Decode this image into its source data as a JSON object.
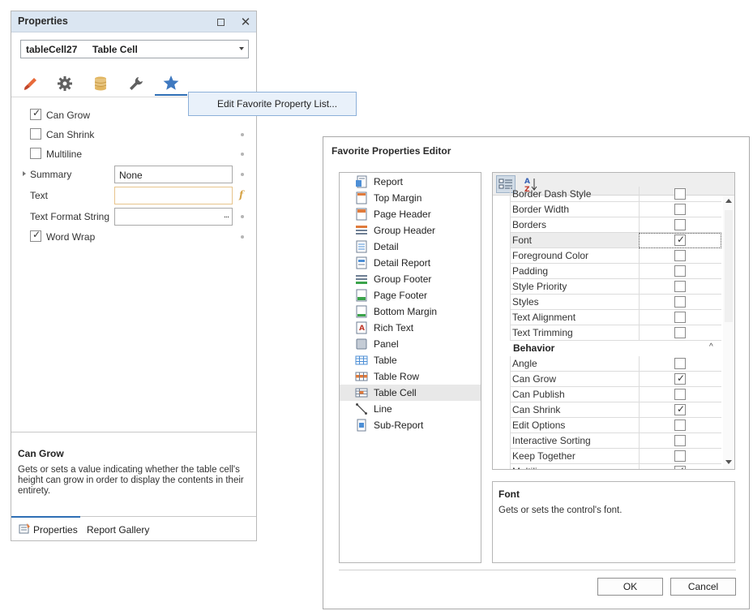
{
  "properties_panel": {
    "title": "Properties",
    "restore_icon": "restore-window-icon",
    "close_glyph": "✕",
    "selected_object": {
      "name": "tableCell27",
      "type": "Table Cell"
    },
    "tabs": [
      {
        "icon": "brush-icon"
      },
      {
        "icon": "gear-icon"
      },
      {
        "icon": "database-icon"
      },
      {
        "icon": "wrench-icon"
      },
      {
        "icon": "star-icon",
        "active": true
      }
    ],
    "context_menu": {
      "item": "Edit Favorite Property List..."
    },
    "props": {
      "can_grow": {
        "label": "Can Grow",
        "checked": true
      },
      "can_shrink": {
        "label": "Can Shrink",
        "checked": false
      },
      "multiline": {
        "label": "Multiline",
        "checked": false
      },
      "summary": {
        "label": "Summary",
        "value": "None"
      },
      "text": {
        "label": "Text",
        "value": ""
      },
      "text_format": {
        "label": "Text Format String",
        "value": "",
        "button": "..."
      },
      "word_wrap": {
        "label": "Word Wrap",
        "checked": true
      }
    },
    "fx_glyph": "f",
    "check_glyph": "✓",
    "description": {
      "title": "Can Grow",
      "text": "Gets or sets a value indicating whether the table cell's height can grow in order to display the contents in their entirety."
    },
    "bottom_tabs": [
      "Properties",
      "Report Gallery"
    ]
  },
  "editor": {
    "title": "Favorite Properties Editor",
    "elements": [
      {
        "label": "Report",
        "icon": "report-icon"
      },
      {
        "label": "Top Margin",
        "icon": "top-margin-icon"
      },
      {
        "label": "Page Header",
        "icon": "page-header-icon"
      },
      {
        "label": "Group Header",
        "icon": "group-header-icon"
      },
      {
        "label": "Detail",
        "icon": "detail-icon"
      },
      {
        "label": "Detail Report",
        "icon": "detail-report-icon"
      },
      {
        "label": "Group Footer",
        "icon": "group-footer-icon"
      },
      {
        "label": "Page Footer",
        "icon": "page-footer-icon"
      },
      {
        "label": "Bottom Margin",
        "icon": "bottom-margin-icon"
      },
      {
        "label": "Rich Text",
        "icon": "rich-text-icon"
      },
      {
        "label": "Panel",
        "icon": "panel-icon"
      },
      {
        "label": "Table",
        "icon": "table-icon"
      },
      {
        "label": "Table Row",
        "icon": "table-row-icon"
      },
      {
        "label": "Table Cell",
        "icon": "table-cell-icon",
        "selected": true
      },
      {
        "label": "Line",
        "icon": "line-icon"
      },
      {
        "label": "Sub-Report",
        "icon": "sub-report-icon"
      }
    ],
    "toolbar": {
      "categorized_icon": "categorized-view-icon",
      "alpha_icon": "sort-alphabetical-icon"
    },
    "grid": {
      "appearance_rows": [
        {
          "name": "Border Dash Style",
          "checked": false
        },
        {
          "name": "Border Width",
          "checked": false
        },
        {
          "name": "Borders",
          "checked": false
        },
        {
          "name": "Font",
          "checked": true,
          "focused": true
        },
        {
          "name": "Foreground Color",
          "checked": false
        },
        {
          "name": "Padding",
          "checked": false
        },
        {
          "name": "Style Priority",
          "checked": false
        },
        {
          "name": "Styles",
          "checked": false
        },
        {
          "name": "Text Alignment",
          "checked": false
        },
        {
          "name": "Text Trimming",
          "checked": false
        }
      ],
      "behavior_category": "Behavior",
      "behavior_rows": [
        {
          "name": "Angle",
          "checked": false
        },
        {
          "name": "Can Grow",
          "checked": true
        },
        {
          "name": "Can Publish",
          "checked": false
        },
        {
          "name": "Can Shrink",
          "checked": true
        },
        {
          "name": "Edit Options",
          "checked": false
        },
        {
          "name": "Interactive Sorting",
          "checked": false
        },
        {
          "name": "Keep Together",
          "checked": false
        },
        {
          "name": "Multiline",
          "checked": true
        }
      ],
      "collapse_glyph": "^"
    },
    "description": {
      "title": "Font",
      "text": "Gets or sets the control's font."
    },
    "ok_label": "OK",
    "cancel_label": "Cancel"
  }
}
